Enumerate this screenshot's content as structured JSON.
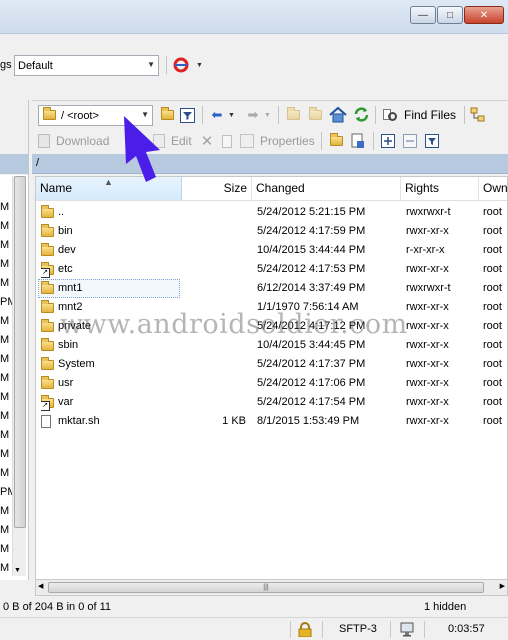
{
  "window": {
    "controls": {
      "minimize": "—",
      "maximize": "□",
      "close": "✕"
    }
  },
  "settings_bar": {
    "label_fragment": "gs",
    "value": "Default"
  },
  "remote_toolbar": {
    "path_combo": "/ <root>",
    "find_files": "Find Files",
    "download": "Download",
    "edit": "Edit",
    "properties": "Properties"
  },
  "path": "/",
  "left_pane": {
    "letters": [
      "M",
      "M",
      "M",
      "M",
      "M",
      "PM",
      "M",
      "M",
      "M",
      "M",
      "M",
      "M",
      "M",
      "M",
      "M",
      "PM",
      "M",
      "M",
      "M",
      "M"
    ]
  },
  "file_list": {
    "columns": [
      "Name",
      "Size",
      "Changed",
      "Rights",
      "Owner"
    ],
    "rows": [
      {
        "name": "..",
        "size": "",
        "changed": "5/24/2012 5:21:15 PM",
        "rights": "rwxrwxr-t",
        "owner": "root",
        "icon": "parent-folder-icon"
      },
      {
        "name": "bin",
        "size": "",
        "changed": "5/24/2012 4:17:59 PM",
        "rights": "rwxr-xr-x",
        "owner": "root",
        "icon": "folder-icon"
      },
      {
        "name": "dev",
        "size": "",
        "changed": "10/4/2015 3:44:44 PM",
        "rights": "r-xr-xr-x",
        "owner": "root",
        "icon": "folder-icon"
      },
      {
        "name": "etc",
        "size": "",
        "changed": "5/24/2012 4:17:53 PM",
        "rights": "rwxr-xr-x",
        "owner": "root",
        "icon": "folder-link-icon"
      },
      {
        "name": "mnt1",
        "size": "",
        "changed": "6/12/2014 3:37:49 PM",
        "rights": "rwxrwxr-t",
        "owner": "root",
        "icon": "folder-icon"
      },
      {
        "name": "mnt2",
        "size": "",
        "changed": "1/1/1970 7:56:14 AM",
        "rights": "rwxr-xr-x",
        "owner": "root",
        "icon": "folder-icon"
      },
      {
        "name": "private",
        "size": "",
        "changed": "5/24/2012 4:17:12 PM",
        "rights": "rwxr-xr-x",
        "owner": "root",
        "icon": "folder-icon"
      },
      {
        "name": "sbin",
        "size": "",
        "changed": "10/4/2015 3:44:45 PM",
        "rights": "rwxr-xr-x",
        "owner": "root",
        "icon": "folder-icon"
      },
      {
        "name": "System",
        "size": "",
        "changed": "5/24/2012 4:17:37 PM",
        "rights": "rwxr-xr-x",
        "owner": "root",
        "icon": "folder-icon"
      },
      {
        "name": "usr",
        "size": "",
        "changed": "5/24/2012 4:17:06 PM",
        "rights": "rwxr-xr-x",
        "owner": "root",
        "icon": "folder-icon"
      },
      {
        "name": "var",
        "size": "",
        "changed": "5/24/2012 4:17:54 PM",
        "rights": "rwxr-xr-x",
        "owner": "root",
        "icon": "folder-link-icon"
      },
      {
        "name": "mktar.sh",
        "size": "1 KB",
        "changed": "8/1/2015 1:53:49 PM",
        "rights": "rwxr-xr-x",
        "owner": "root",
        "icon": "file-icon"
      }
    ]
  },
  "info_bar": {
    "selection": "0 B of 204 B in 0 of 11",
    "hidden": "1 hidden"
  },
  "status_bar": {
    "protocol": "SFTP-3",
    "time": "0:03:57"
  },
  "watermark": "www.androidsoldier.com",
  "colors": {
    "accent_pointer": "#4a1ee8",
    "path_bar": "#b7c9de"
  }
}
